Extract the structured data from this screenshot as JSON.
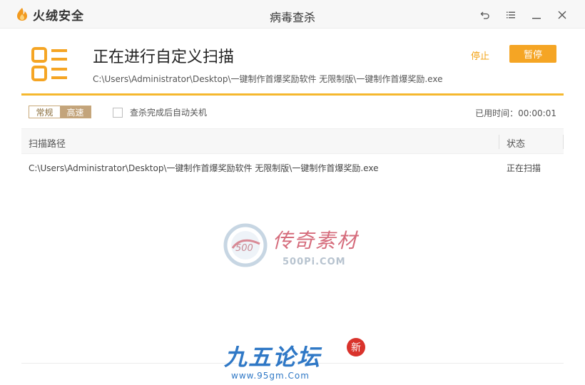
{
  "app": {
    "name": "火绒安全",
    "window_title": "病毒查杀"
  },
  "window_controls": {
    "back_icon": "undo-icon",
    "menu_icon": "menu-icon",
    "minimize_icon": "minimize-icon",
    "close_icon": "close-icon"
  },
  "scan": {
    "title": "正在进行自定义扫描",
    "current_path": "C:\\Users\\Administrator\\Desktop\\一键制作首爆奖励软件 无限制版\\一键制作首爆奖励.exe",
    "stop_label": "停止",
    "pause_label": "暂停",
    "progress_percent": 100
  },
  "options": {
    "speed_normal": "常规",
    "speed_fast": "高速",
    "speed_selected": "高速",
    "auto_shutdown_label": "查杀完成后自动关机",
    "auto_shutdown_checked": false,
    "elapsed_label": "已用时间：00:00:01"
  },
  "table": {
    "headers": {
      "path": "扫描路径",
      "status": "状态"
    },
    "rows": [
      {
        "path": "C:\\Users\\Administrator\\Desktop\\一键制作首爆奖励软件 无限制版\\一键制作首爆奖励.exe",
        "status": "正在扫描"
      }
    ]
  },
  "watermarks": {
    "wm1_brand": "传奇素材",
    "wm1_url": "500Pi.COM",
    "wm2_brand": "九五论坛",
    "wm2_badge": "新",
    "wm2_url": "www.95gm.Com"
  },
  "colors": {
    "accent": "#f5a524",
    "progress": "#f5b82e",
    "stop_link": "#f3a316",
    "speed_selected_bg": "#c3a47b"
  }
}
